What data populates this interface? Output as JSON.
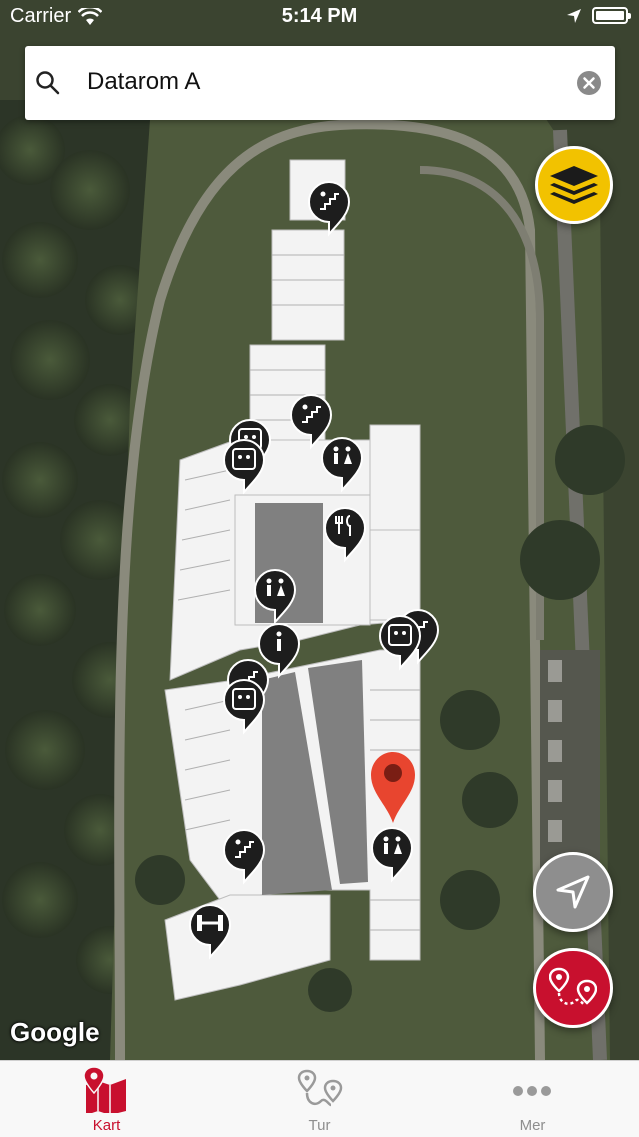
{
  "status_bar": {
    "carrier": "Carrier",
    "time": "5:14 PM"
  },
  "search": {
    "query": "Datarom A"
  },
  "map": {
    "attribution": "Google",
    "selected_pin_color": "#e8452f"
  },
  "tabs": [
    {
      "label": "Kart",
      "icon": "map-icon",
      "active": true
    },
    {
      "label": "Tur",
      "icon": "route-icon",
      "active": false
    },
    {
      "label": "Mer",
      "icon": "more-icon",
      "active": false
    }
  ],
  "colors": {
    "accent": "#c8102e",
    "layers_button": "#f2c200",
    "locate_button": "#8e8e8e",
    "route_button": "#c8102e"
  }
}
